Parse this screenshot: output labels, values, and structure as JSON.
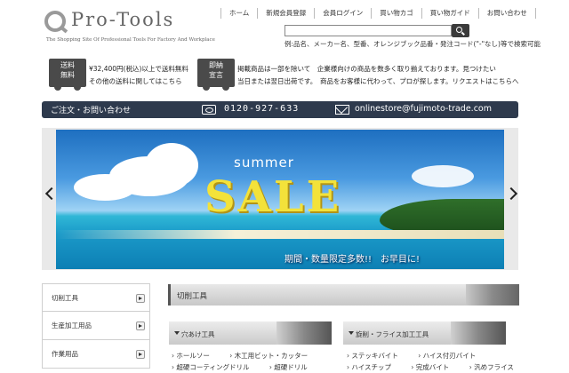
{
  "logo": {
    "name": "Pro-Tools",
    "tagline": "The Shopping Site Of Professional Tools For Factory And Workplace"
  },
  "topnav": [
    "ホーム",
    "新規会員登録",
    "会員ログイン",
    "買い物カゴ",
    "買い物ガイド",
    "お問い合わせ"
  ],
  "search": {
    "value": "",
    "hint": "例:品名、メーカー名、型番、オレンジブック品番・発注コード(\"-\"なし)等で検索可能"
  },
  "shipping": {
    "badge_line1": "送料",
    "badge_line2": "無料",
    "line1": "¥32,400円(税込)以上で送料無料",
    "line2": "その他の送料に関してはこちら"
  },
  "sameday": {
    "badge_line1": "即納",
    "badge_line2": "宣言",
    "line1": "掲載商品は一部を除いて　企業様向けの商品を数多く取り揃えております。見つけたい",
    "line2": "当日または翌日出荷です。　商品をお客様に代わって、プロが探します。リクエストはこちらへ"
  },
  "contact": {
    "label": "ご注文・お問い合わせ",
    "phone": "0120-927-633",
    "email": "onlinestore@fujimoto-trade.com"
  },
  "banner": {
    "summer": "summer",
    "sale": "SALE",
    "promo": "期間・数量限定多数!!　お早目に!"
  },
  "sidebar": [
    "切削工具",
    "生産加工用品",
    "作業用品"
  ],
  "category": {
    "title": "切削工具",
    "sub1": {
      "title": "穴あけ工具",
      "links_row1": [
        "ホールソー",
        "木工用ビット・カッター"
      ],
      "links_row2": [
        "超硬コーティングドリル",
        "超硬ドリル"
      ]
    },
    "sub2": {
      "title": "旋削・フライス加工工具",
      "links_row1": [
        "ステッキバイト",
        "ハイス付刃バイト"
      ],
      "links_row2": [
        "ハイスチップ",
        "完成バイト",
        "汎めフライス"
      ]
    }
  },
  "colors": {
    "contact_bar": "#2e3a4d",
    "sale_text": "#f3e23a",
    "badge": "#4a4a4a"
  }
}
